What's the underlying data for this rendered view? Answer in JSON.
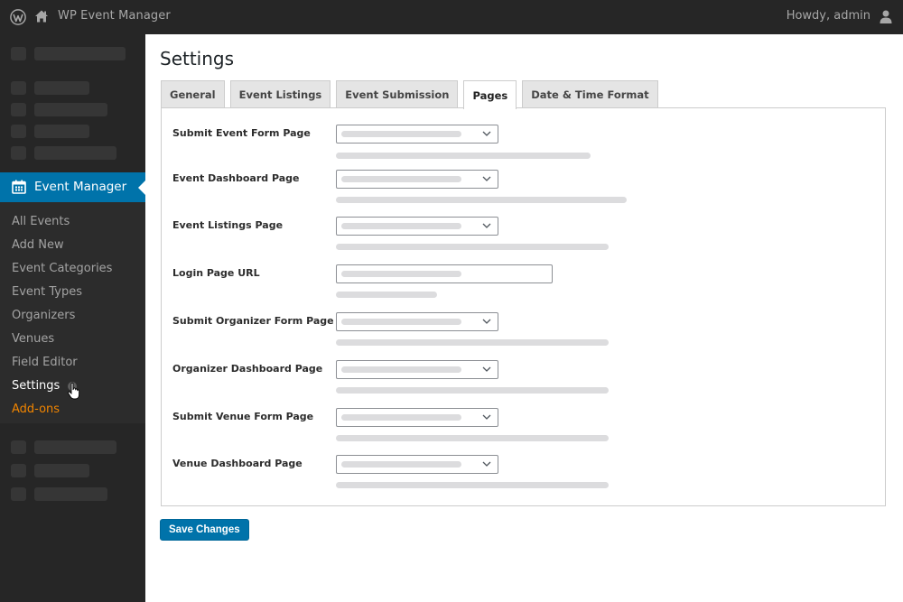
{
  "adminbar": {
    "logo_icon": "wordpress-icon",
    "home_icon": "home-icon",
    "site_name": "WP Event Manager",
    "greeting": "Howdy, admin",
    "user_icon": "user-icon"
  },
  "sidebar": {
    "active_menu": {
      "icon": "calendar-icon",
      "label": "Event Manager"
    },
    "submenu": [
      {
        "label": "All Events"
      },
      {
        "label": "Add New"
      },
      {
        "label": "Event Categories"
      },
      {
        "label": "Event Types"
      },
      {
        "label": "Organizers"
      },
      {
        "label": "Venues"
      },
      {
        "label": "Field Editor"
      },
      {
        "label": "Settings",
        "current": true
      },
      {
        "label": "Add-ons",
        "highlight": true
      }
    ],
    "colors": {
      "background": "#262626",
      "active": "#0073aa",
      "addons": "#f18500"
    }
  },
  "main": {
    "title": "Settings",
    "tabs": [
      {
        "label": "General"
      },
      {
        "label": "Event Listings"
      },
      {
        "label": "Event Submission"
      },
      {
        "label": "Pages",
        "active": true
      },
      {
        "label": "Date & Time Format"
      }
    ],
    "fields": [
      {
        "label": "Submit Event Form Page",
        "type": "select"
      },
      {
        "label": "Event Dashboard Page",
        "type": "select"
      },
      {
        "label": "Event Listings Page",
        "type": "select"
      },
      {
        "label": "Login Page URL",
        "type": "text"
      },
      {
        "label": "Submit Organizer Form Page",
        "type": "select"
      },
      {
        "label": "Organizer Dashboard Page",
        "type": "select"
      },
      {
        "label": "Submit Venue Form Page",
        "type": "select"
      },
      {
        "label": "Venue Dashboard Page",
        "type": "select"
      }
    ],
    "save_label": "Save Changes"
  }
}
